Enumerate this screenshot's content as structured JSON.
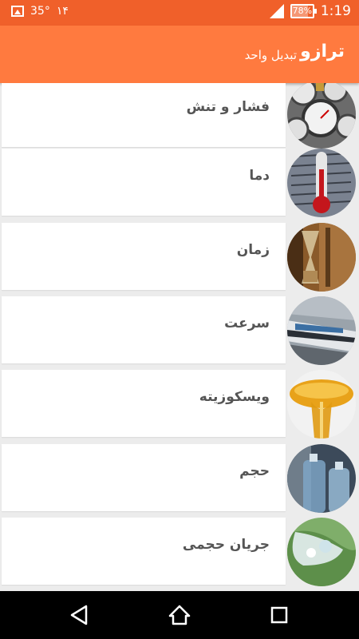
{
  "status_bar": {
    "temperature": "35°",
    "notification_number": "۱۴",
    "battery": "78%",
    "battery_level": 0.78,
    "time": "1:19"
  },
  "app_bar": {
    "title": "ترازو",
    "subtitle": "تبدیل واحد",
    "color": "#ff7a3f"
  },
  "list": {
    "items": [
      {
        "label": "فشار و تنش",
        "image": "pressure-gauges"
      },
      {
        "label": "دما",
        "image": "thermometer"
      },
      {
        "label": "زمان",
        "image": "hourglass"
      },
      {
        "label": "سرعت",
        "image": "train"
      },
      {
        "label": "ویسکوزیته",
        "image": "honey"
      },
      {
        "label": "حجم",
        "image": "water-bottles"
      },
      {
        "label": "جریان حجمی",
        "image": "water-flow"
      }
    ]
  },
  "navigation": {
    "back": "back-icon",
    "home": "home-icon",
    "recents": "recents-icon"
  }
}
